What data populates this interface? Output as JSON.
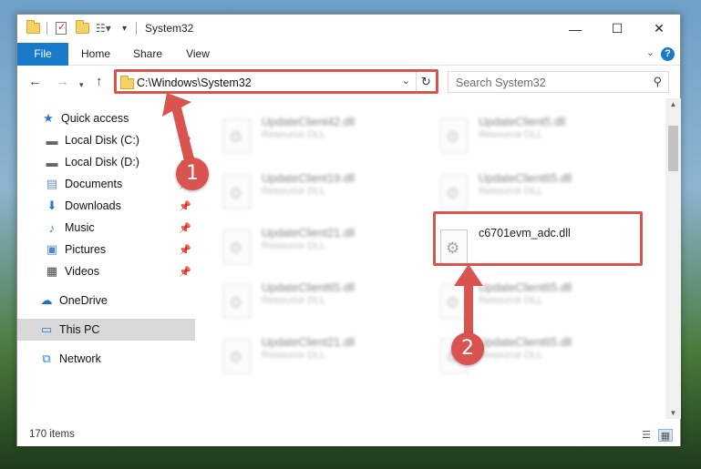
{
  "window": {
    "title": "System32",
    "controls": {
      "minimize": "—",
      "maximize": "☐",
      "close": "✕"
    }
  },
  "ribbon": {
    "tabs": [
      "File",
      "Home",
      "Share",
      "View"
    ],
    "help": "?"
  },
  "address_bar": {
    "path": "C:\\Windows\\System32",
    "search_placeholder": "Search System32"
  },
  "nav_pane": {
    "items": [
      {
        "label": "Quick access",
        "icon": "star-icon"
      },
      {
        "label": "Local Disk (C:)",
        "icon": "drive-icon"
      },
      {
        "label": "Local Disk (D:)",
        "icon": "drive-icon"
      },
      {
        "label": "Documents",
        "icon": "document-icon"
      },
      {
        "label": "Downloads",
        "icon": "download-icon"
      },
      {
        "label": "Music",
        "icon": "music-icon"
      },
      {
        "label": "Pictures",
        "icon": "picture-icon"
      },
      {
        "label": "Videos",
        "icon": "video-icon"
      },
      {
        "label": "OneDrive",
        "icon": "cloud-icon"
      },
      {
        "label": "This PC",
        "icon": "computer-icon",
        "selected": true
      },
      {
        "label": "Network",
        "icon": "network-icon"
      }
    ]
  },
  "files": [
    {
      "name": "UpdateClient42.dll",
      "type": "Resource DLL"
    },
    {
      "name": "UpdateClient5.dll",
      "type": "Resource DLL"
    },
    {
      "name": "UpdateClient19.dll",
      "type": "Resource DLL"
    },
    {
      "name": "UpdateClient65.dll",
      "type": "Resource DLL"
    },
    {
      "name": "UpdateClient21.dll",
      "type": "Resource DLL"
    },
    {
      "name": "c6701evm_adc.dll",
      "type": ""
    },
    {
      "name": "UpdateClient65.dll",
      "type": "Resource DLL"
    },
    {
      "name": "UpdateClient65.dll",
      "type": "Resource DLL"
    },
    {
      "name": "UpdateClient21.dll",
      "type": "Resource DLL"
    },
    {
      "name": "UpdateClient65.dll",
      "type": "Resource DLL"
    }
  ],
  "status_bar": {
    "item_count": "170 items"
  },
  "annotations": {
    "step1": "1",
    "step2": "2",
    "color": "#d9534f"
  }
}
